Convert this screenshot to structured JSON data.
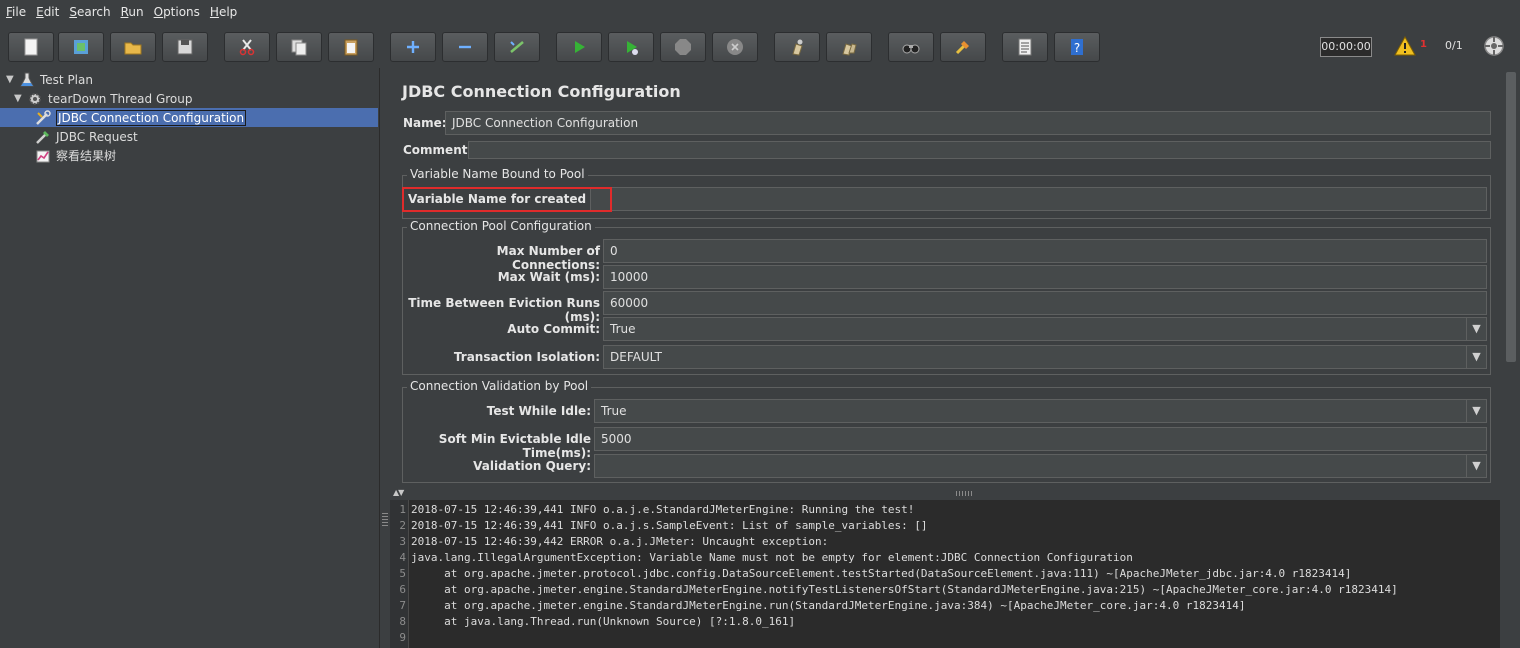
{
  "menu": [
    "File",
    "Edit",
    "Search",
    "Run",
    "Options",
    "Help"
  ],
  "toolbar": {
    "buttons": [
      "new-icon",
      "templates-icon",
      "open-icon",
      "save-icon",
      "cut-icon",
      "copy-icon",
      "paste-icon",
      "expand-icon",
      "collapse-icon",
      "toggle-icon",
      "start-icon",
      "start-no-pause-icon",
      "stop-icon",
      "shutdown-icon",
      "clear-icon",
      "clear-all-icon",
      "search-icon",
      "reset-search-icon",
      "function-helper-icon",
      "help-icon"
    ],
    "timer": "00:00:00",
    "error_count": "1",
    "threads": "0/1"
  },
  "tree": {
    "items": [
      {
        "label": "Test Plan",
        "icon": "test-plan-icon"
      },
      {
        "label": "tearDown Thread Group",
        "icon": "gear-icon"
      },
      {
        "label": "JDBC Connection Configuration",
        "icon": "wrench-icon"
      },
      {
        "label": "JDBC Request",
        "icon": "pipette-icon"
      },
      {
        "label": "察看结果树",
        "icon": "chart-icon"
      }
    ],
    "selected_index": 2
  },
  "panel": {
    "title": "JDBC Connection Configuration",
    "name_label": "Name:",
    "name_value": "JDBC Connection Configuration",
    "comments_label": "Comments:",
    "comments_value": "",
    "group_pool_var": {
      "title": "Variable Name Bound to Pool",
      "var_label": "Variable Name for created pool:",
      "var_value": ""
    },
    "group_pool_cfg": {
      "title": "Connection Pool Configuration",
      "max_conn_label": "Max Number of Connections:",
      "max_conn_value": "0",
      "max_wait_label": "Max Wait (ms):",
      "max_wait_value": "10000",
      "eviction_label": "Time Between Eviction Runs (ms):",
      "eviction_value": "60000",
      "auto_commit_label": "Auto Commit:",
      "auto_commit_value": "True",
      "isolation_label": "Transaction Isolation:",
      "isolation_value": "DEFAULT"
    },
    "group_validation": {
      "title": "Connection Validation by Pool",
      "test_idle_label": "Test While Idle:",
      "test_idle_value": "True",
      "soft_min_label": "Soft Min Evictable Idle Time(ms):",
      "soft_min_value": "5000",
      "query_label": "Validation Query:",
      "query_value": ""
    }
  },
  "log": {
    "lines": [
      {
        "n": "1",
        "text": "2018-07-15 12:46:39,441 INFO o.a.j.e.StandardJMeterEngine: Running the test!"
      },
      {
        "n": "2",
        "text": "2018-07-15 12:46:39,441 INFO o.a.j.s.SampleEvent: List of sample_variables: []"
      },
      {
        "n": "3",
        "text": "2018-07-15 12:46:39,442 ERROR o.a.j.JMeter: Uncaught exception:"
      },
      {
        "n": "4",
        "text": "java.lang.IllegalArgumentException: Variable Name must not be empty for element:JDBC Connection Configuration"
      },
      {
        "n": "5",
        "text": "     at org.apache.jmeter.protocol.jdbc.config.DataSourceElement.testStarted(DataSourceElement.java:111) ~[ApacheJMeter_jdbc.jar:4.0 r1823414]"
      },
      {
        "n": "6",
        "text": "     at org.apache.jmeter.engine.StandardJMeterEngine.notifyTestListenersOfStart(StandardJMeterEngine.java:215) ~[ApacheJMeter_core.jar:4.0 r1823414]"
      },
      {
        "n": "7",
        "text": "     at org.apache.jmeter.engine.StandardJMeterEngine.run(StandardJMeterEngine.java:384) ~[ApacheJMeter_core.jar:4.0 r1823414]"
      },
      {
        "n": "8",
        "text": "     at java.lang.Thread.run(Unknown Source) [?:1.8.0_161]"
      },
      {
        "n": "9",
        "text": ""
      }
    ]
  }
}
